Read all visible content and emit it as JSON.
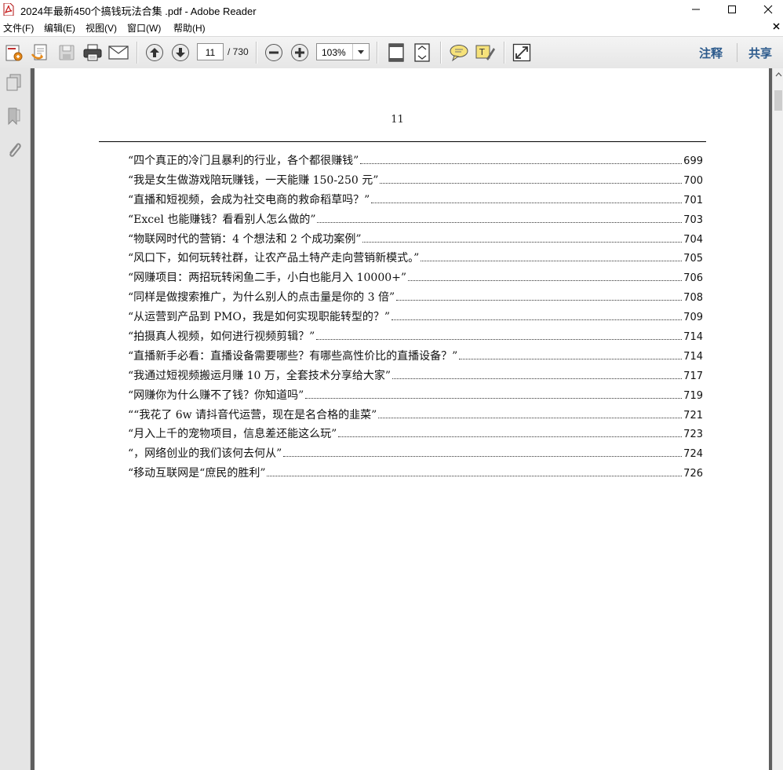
{
  "window": {
    "title": "2024年最新450个搞钱玩法合集 .pdf - Adobe Reader"
  },
  "menu": {
    "items": [
      "文件(F)",
      "编辑(E)",
      "视图(V)",
      "窗口(W)",
      "帮助(H)"
    ]
  },
  "toolbar": {
    "current_page": "11",
    "total_pages": "/ 730",
    "zoom": "103%",
    "comment_label": "注释",
    "share_label": "共享"
  },
  "page": {
    "header_number": "11",
    "toc": [
      {
        "title": "“四个真正的冷门且暴利的行业，各个都很赚钱”",
        "page": "699"
      },
      {
        "title": "“我是女生做游戏陪玩赚钱，一天能赚 150-250 元”",
        "page": "700"
      },
      {
        "title": "“直播和短视频，会成为社交电商的救命稻草吗？”",
        "page": "701"
      },
      {
        "title": "“Excel 也能赚钱？看看别人怎么做的”",
        "page": "703"
      },
      {
        "title": "“物联网时代的营销：4 个想法和 2 个成功案例”",
        "page": "704"
      },
      {
        "title": "“风口下，如何玩转社群，让农产品土特产走向营销新模式。”",
        "page": "705"
      },
      {
        "title": "“网赚项目：两招玩转闲鱼二手，小白也能月入 10000+”",
        "page": "706"
      },
      {
        "title": "“同样是做搜索推广，为什么别人的点击量是你的 3 倍”",
        "page": "708"
      },
      {
        "title": "“从运营到产品到 PMO，我是如何实现职能转型的？”",
        "page": "709"
      },
      {
        "title": "“拍摄真人视频，如何进行视频剪辑？”",
        "page": "714"
      },
      {
        "title": "“直播新手必看：直播设备需要哪些？有哪些高性价比的直播设备？”",
        "page": "714"
      },
      {
        "title": "“我通过短视频搬运月赚 10 万，全套技术分享给大家”",
        "page": "717"
      },
      {
        "title": "“网赚你为什么赚不了钱？你知道吗”",
        "page": "719"
      },
      {
        "title": "““我花了 6w 请抖音代运营，现在是名合格的韭菜”",
        "page": "721"
      },
      {
        "title": "“月入上千的宠物项目，信息差还能这么玩”",
        "page": "723"
      },
      {
        "title": "“，网络创业的我们该何去何从”",
        "page": "724"
      },
      {
        "title": "“移动互联网是“庶民的胜利”",
        "page": "726"
      }
    ]
  },
  "icons": {
    "app": "pdf-app-icon",
    "accent_color": "#2c5a8c"
  }
}
